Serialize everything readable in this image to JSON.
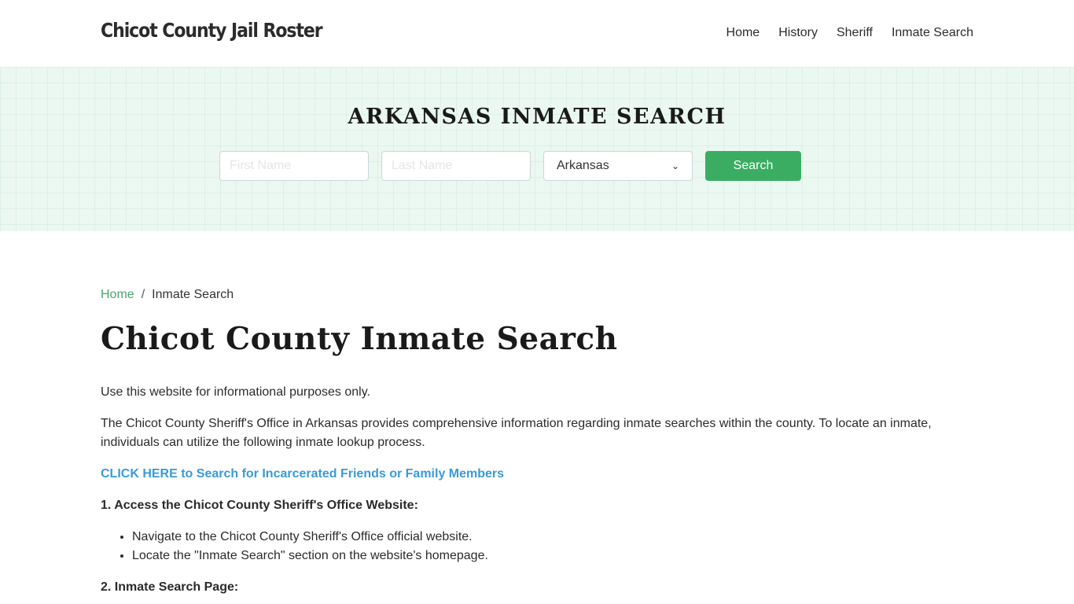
{
  "header": {
    "brand": "Chicot County Jail Roster",
    "nav": [
      "Home",
      "History",
      "Sheriff",
      "Inmate Search"
    ]
  },
  "hero": {
    "title": "ARKANSAS INMATE SEARCH",
    "first_name_placeholder": "First Name",
    "last_name_placeholder": "Last Name",
    "state_selected": "Arkansas",
    "search_label": "Search"
  },
  "breadcrumb": {
    "home": "Home",
    "separator": "/",
    "current": "Inmate Search"
  },
  "main": {
    "title": "Chicot County Inmate Search",
    "intro": "Use this website for informational purposes only.",
    "description": "The Chicot County Sheriff's Office in Arkansas provides comprehensive information regarding inmate searches within the county. To locate an inmate, individuals can utilize the following inmate lookup process.",
    "cta_link": "CLICK HERE to Search for Incarcerated Friends or Family Members",
    "step1_title": "1. Access the Chicot County Sheriff's Office Website:",
    "step1_items": [
      "Navigate to the Chicot County Sheriff's Office official website.",
      "Locate the \"Inmate Search\" section on the website's homepage."
    ],
    "step2_title": "2. Inmate Search Page:"
  },
  "colors": {
    "accent_green": "#3aad63",
    "link_blue": "#3a9ad9",
    "breadcrumb_green": "#4ea46c",
    "hero_bg": "#ebf8f1"
  }
}
